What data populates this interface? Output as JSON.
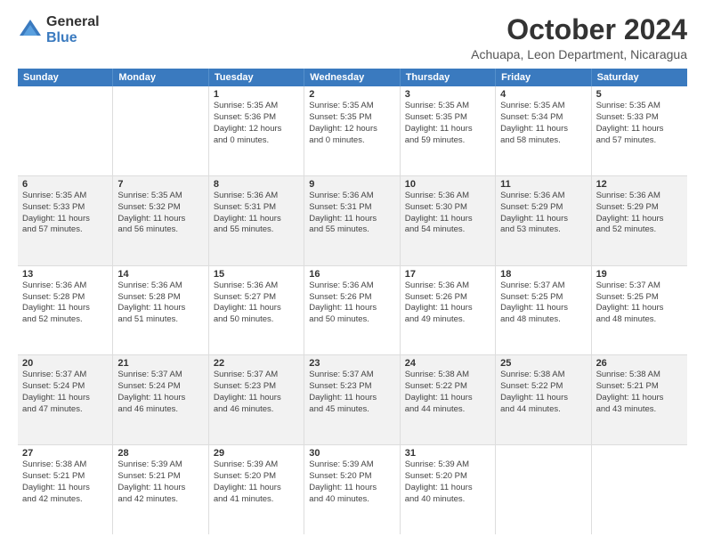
{
  "logo": {
    "general": "General",
    "blue": "Blue"
  },
  "title": "October 2024",
  "subtitle": "Achuapa, Leon Department, Nicaragua",
  "header_days": [
    "Sunday",
    "Monday",
    "Tuesday",
    "Wednesday",
    "Thursday",
    "Friday",
    "Saturday"
  ],
  "rows": [
    {
      "alt": false,
      "cells": [
        {
          "day": "",
          "lines": []
        },
        {
          "day": "",
          "lines": []
        },
        {
          "day": "1",
          "lines": [
            "Sunrise: 5:35 AM",
            "Sunset: 5:36 PM",
            "Daylight: 12 hours",
            "and 0 minutes."
          ]
        },
        {
          "day": "2",
          "lines": [
            "Sunrise: 5:35 AM",
            "Sunset: 5:35 PM",
            "Daylight: 12 hours",
            "and 0 minutes."
          ]
        },
        {
          "day": "3",
          "lines": [
            "Sunrise: 5:35 AM",
            "Sunset: 5:35 PM",
            "Daylight: 11 hours",
            "and 59 minutes."
          ]
        },
        {
          "day": "4",
          "lines": [
            "Sunrise: 5:35 AM",
            "Sunset: 5:34 PM",
            "Daylight: 11 hours",
            "and 58 minutes."
          ]
        },
        {
          "day": "5",
          "lines": [
            "Sunrise: 5:35 AM",
            "Sunset: 5:33 PM",
            "Daylight: 11 hours",
            "and 57 minutes."
          ]
        }
      ]
    },
    {
      "alt": true,
      "cells": [
        {
          "day": "6",
          "lines": [
            "Sunrise: 5:35 AM",
            "Sunset: 5:33 PM",
            "Daylight: 11 hours",
            "and 57 minutes."
          ]
        },
        {
          "day": "7",
          "lines": [
            "Sunrise: 5:35 AM",
            "Sunset: 5:32 PM",
            "Daylight: 11 hours",
            "and 56 minutes."
          ]
        },
        {
          "day": "8",
          "lines": [
            "Sunrise: 5:36 AM",
            "Sunset: 5:31 PM",
            "Daylight: 11 hours",
            "and 55 minutes."
          ]
        },
        {
          "day": "9",
          "lines": [
            "Sunrise: 5:36 AM",
            "Sunset: 5:31 PM",
            "Daylight: 11 hours",
            "and 55 minutes."
          ]
        },
        {
          "day": "10",
          "lines": [
            "Sunrise: 5:36 AM",
            "Sunset: 5:30 PM",
            "Daylight: 11 hours",
            "and 54 minutes."
          ]
        },
        {
          "day": "11",
          "lines": [
            "Sunrise: 5:36 AM",
            "Sunset: 5:29 PM",
            "Daylight: 11 hours",
            "and 53 minutes."
          ]
        },
        {
          "day": "12",
          "lines": [
            "Sunrise: 5:36 AM",
            "Sunset: 5:29 PM",
            "Daylight: 11 hours",
            "and 52 minutes."
          ]
        }
      ]
    },
    {
      "alt": false,
      "cells": [
        {
          "day": "13",
          "lines": [
            "Sunrise: 5:36 AM",
            "Sunset: 5:28 PM",
            "Daylight: 11 hours",
            "and 52 minutes."
          ]
        },
        {
          "day": "14",
          "lines": [
            "Sunrise: 5:36 AM",
            "Sunset: 5:28 PM",
            "Daylight: 11 hours",
            "and 51 minutes."
          ]
        },
        {
          "day": "15",
          "lines": [
            "Sunrise: 5:36 AM",
            "Sunset: 5:27 PM",
            "Daylight: 11 hours",
            "and 50 minutes."
          ]
        },
        {
          "day": "16",
          "lines": [
            "Sunrise: 5:36 AM",
            "Sunset: 5:26 PM",
            "Daylight: 11 hours",
            "and 50 minutes."
          ]
        },
        {
          "day": "17",
          "lines": [
            "Sunrise: 5:36 AM",
            "Sunset: 5:26 PM",
            "Daylight: 11 hours",
            "and 49 minutes."
          ]
        },
        {
          "day": "18",
          "lines": [
            "Sunrise: 5:37 AM",
            "Sunset: 5:25 PM",
            "Daylight: 11 hours",
            "and 48 minutes."
          ]
        },
        {
          "day": "19",
          "lines": [
            "Sunrise: 5:37 AM",
            "Sunset: 5:25 PM",
            "Daylight: 11 hours",
            "and 48 minutes."
          ]
        }
      ]
    },
    {
      "alt": true,
      "cells": [
        {
          "day": "20",
          "lines": [
            "Sunrise: 5:37 AM",
            "Sunset: 5:24 PM",
            "Daylight: 11 hours",
            "and 47 minutes."
          ]
        },
        {
          "day": "21",
          "lines": [
            "Sunrise: 5:37 AM",
            "Sunset: 5:24 PM",
            "Daylight: 11 hours",
            "and 46 minutes."
          ]
        },
        {
          "day": "22",
          "lines": [
            "Sunrise: 5:37 AM",
            "Sunset: 5:23 PM",
            "Daylight: 11 hours",
            "and 46 minutes."
          ]
        },
        {
          "day": "23",
          "lines": [
            "Sunrise: 5:37 AM",
            "Sunset: 5:23 PM",
            "Daylight: 11 hours",
            "and 45 minutes."
          ]
        },
        {
          "day": "24",
          "lines": [
            "Sunrise: 5:38 AM",
            "Sunset: 5:22 PM",
            "Daylight: 11 hours",
            "and 44 minutes."
          ]
        },
        {
          "day": "25",
          "lines": [
            "Sunrise: 5:38 AM",
            "Sunset: 5:22 PM",
            "Daylight: 11 hours",
            "and 44 minutes."
          ]
        },
        {
          "day": "26",
          "lines": [
            "Sunrise: 5:38 AM",
            "Sunset: 5:21 PM",
            "Daylight: 11 hours",
            "and 43 minutes."
          ]
        }
      ]
    },
    {
      "alt": false,
      "cells": [
        {
          "day": "27",
          "lines": [
            "Sunrise: 5:38 AM",
            "Sunset: 5:21 PM",
            "Daylight: 11 hours",
            "and 42 minutes."
          ]
        },
        {
          "day": "28",
          "lines": [
            "Sunrise: 5:39 AM",
            "Sunset: 5:21 PM",
            "Daylight: 11 hours",
            "and 42 minutes."
          ]
        },
        {
          "day": "29",
          "lines": [
            "Sunrise: 5:39 AM",
            "Sunset: 5:20 PM",
            "Daylight: 11 hours",
            "and 41 minutes."
          ]
        },
        {
          "day": "30",
          "lines": [
            "Sunrise: 5:39 AM",
            "Sunset: 5:20 PM",
            "Daylight: 11 hours",
            "and 40 minutes."
          ]
        },
        {
          "day": "31",
          "lines": [
            "Sunrise: 5:39 AM",
            "Sunset: 5:20 PM",
            "Daylight: 11 hours",
            "and 40 minutes."
          ]
        },
        {
          "day": "",
          "lines": []
        },
        {
          "day": "",
          "lines": []
        }
      ]
    }
  ]
}
